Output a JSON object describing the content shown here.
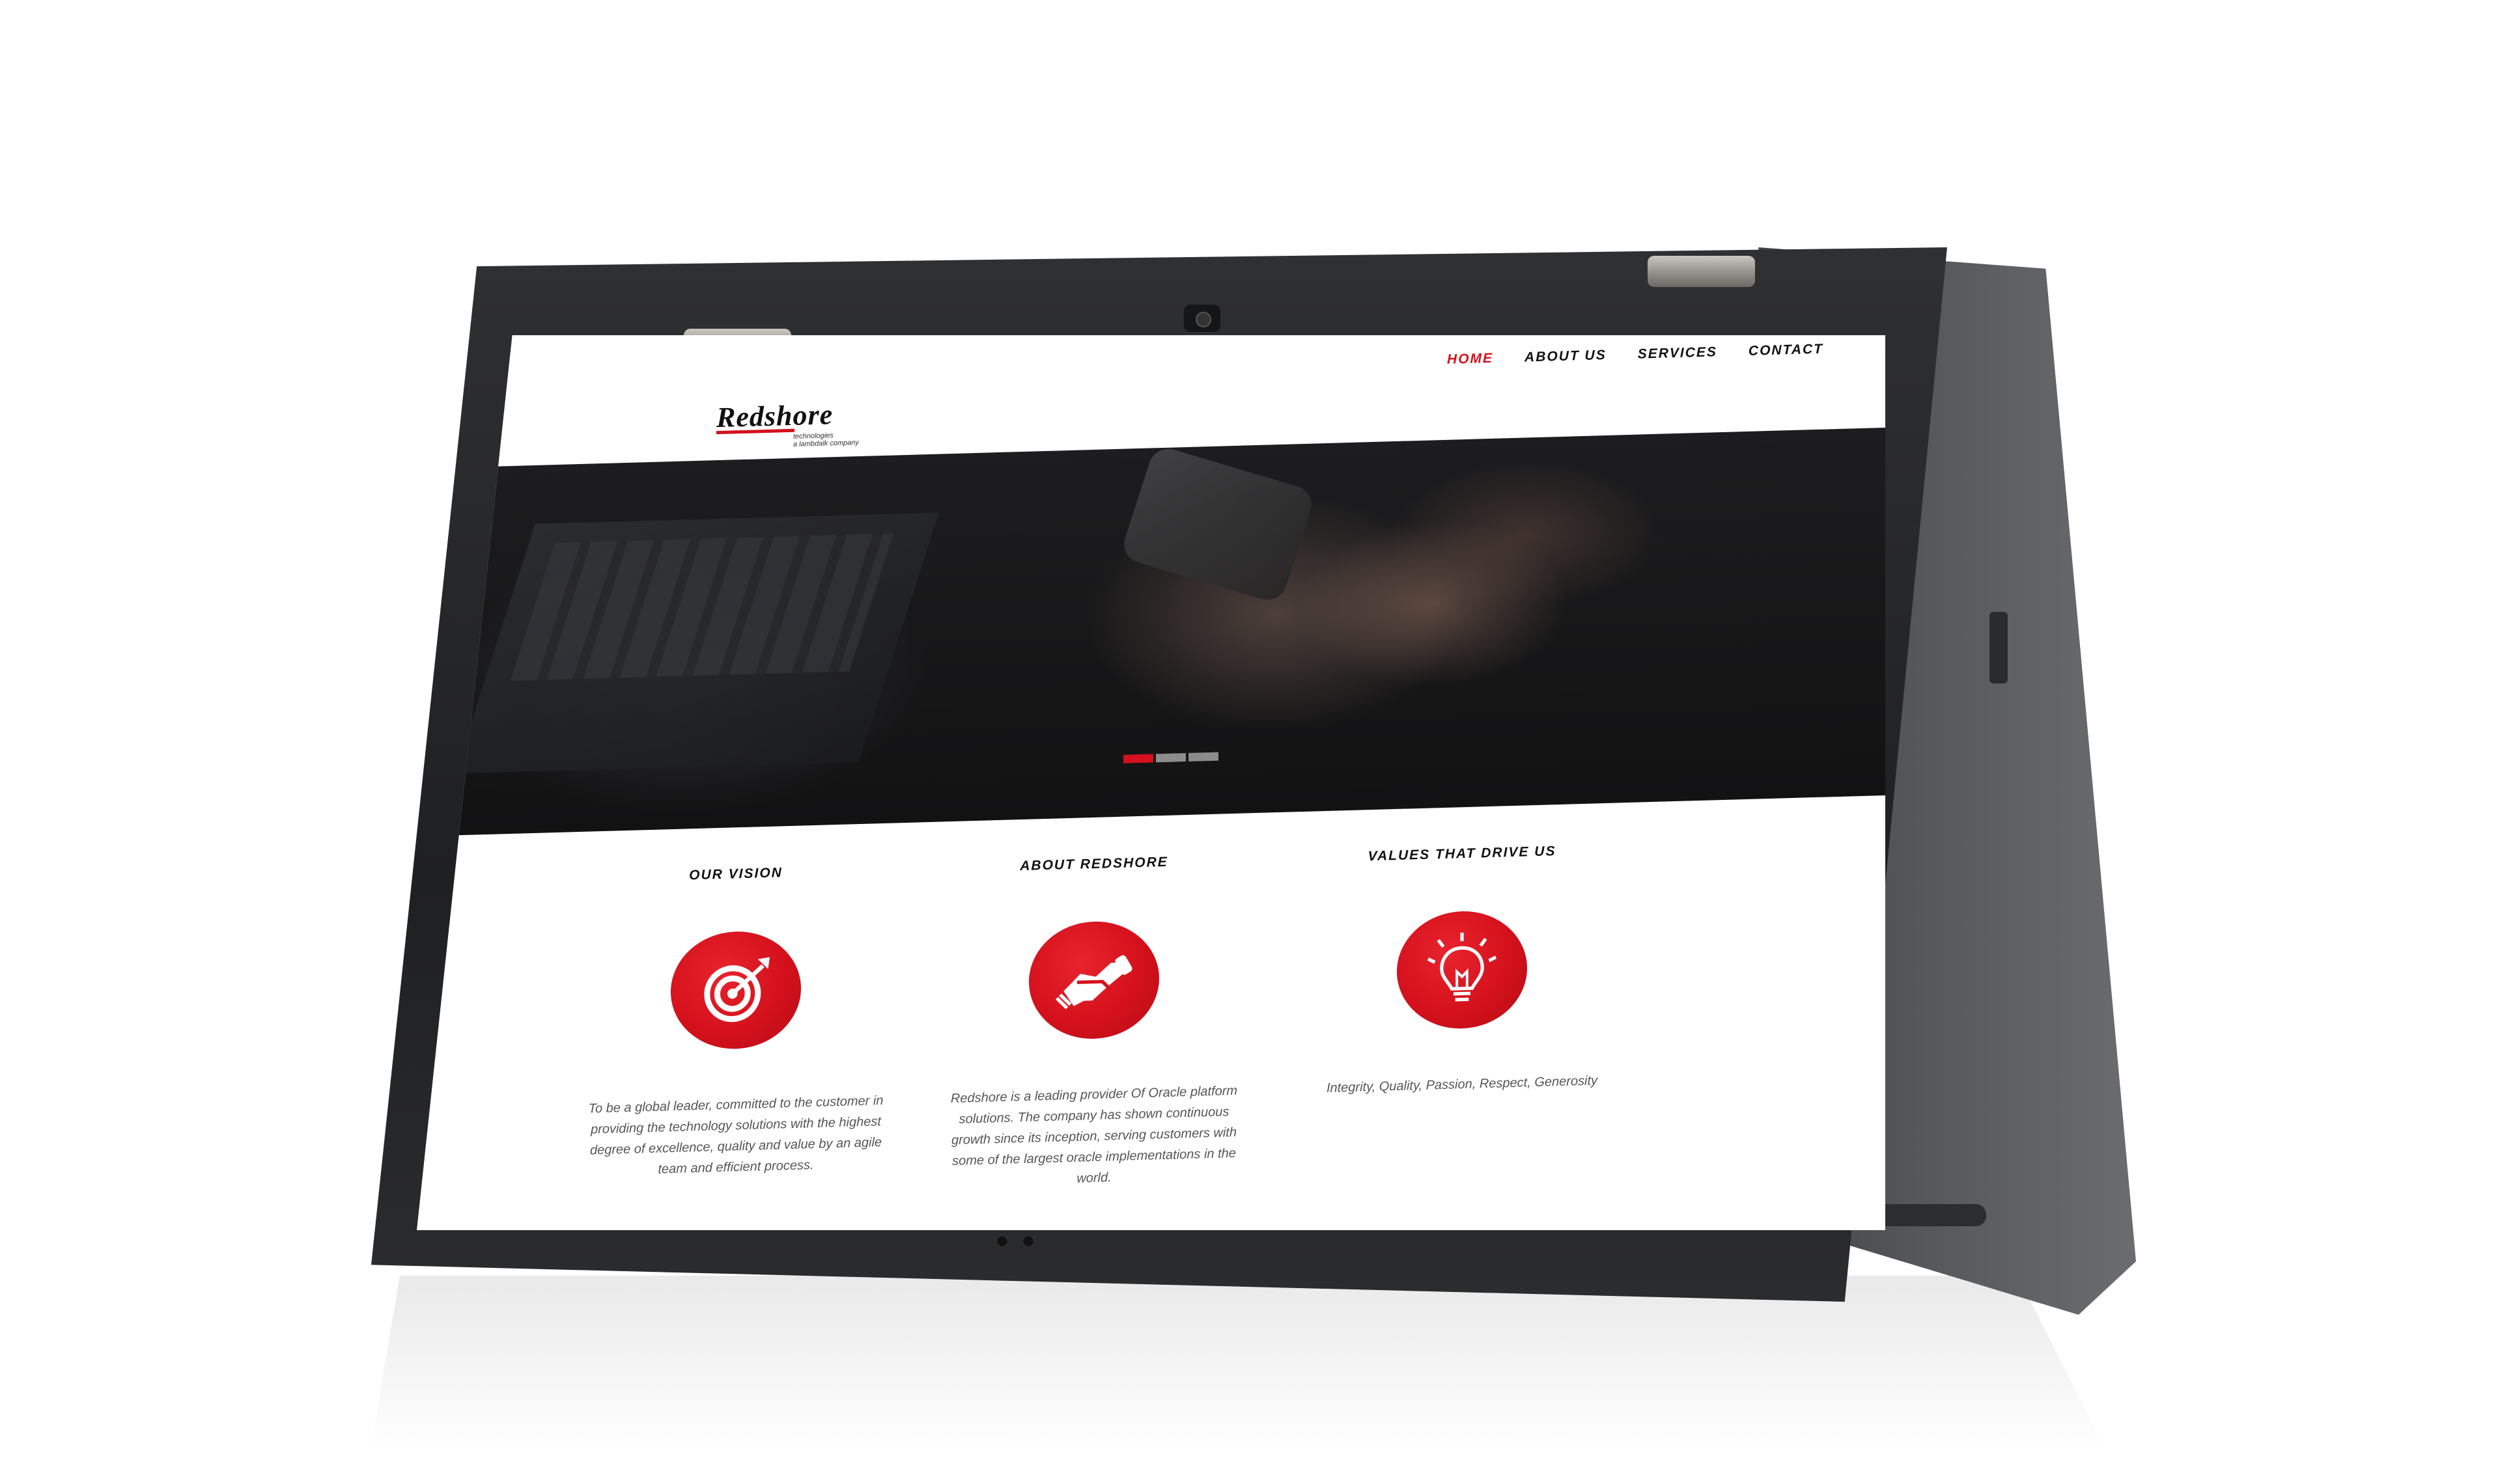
{
  "site": {
    "logo": {
      "name": "Redshore",
      "tag_line1": "technologies",
      "tag_line2": "a lambdalk company"
    },
    "nav": [
      {
        "label": "HOME",
        "active": true
      },
      {
        "label": "ABOUT US",
        "active": false
      },
      {
        "label": "SERVICES",
        "active": false
      },
      {
        "label": "CONTACT",
        "active": false
      }
    ],
    "slider": {
      "slide_count": 3,
      "active_index": 0
    },
    "features": [
      {
        "title": "OUR VISION",
        "icon": "target-icon",
        "text": "To be a global leader, committed to the customer in providing the technology solutions with the highest degree of excellence, quality and value by an agile team and efficient process."
      },
      {
        "title": "ABOUT REDSHORE",
        "icon": "handshake-icon",
        "text": "Redshore is a leading provider Of Oracle platform solutions. The company has shown continuous growth since its inception, serving customers with some of the largest oracle implementations in the world."
      },
      {
        "title": "VALUES THAT DRIVE US",
        "icon": "lightbulb-icon",
        "text": "Integrity, Quality, Passion, Respect, Generosity"
      }
    ],
    "colors": {
      "accent": "#d4111c",
      "text": "#111111",
      "muted": "#555555"
    }
  }
}
